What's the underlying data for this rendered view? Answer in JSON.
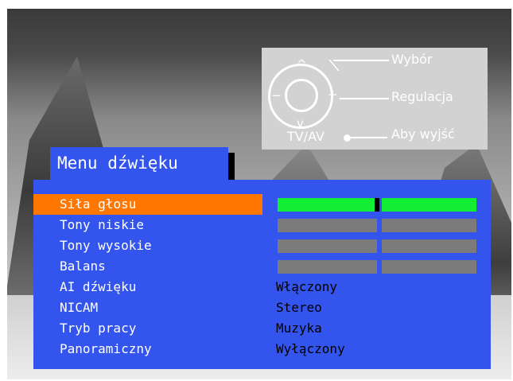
{
  "help": {
    "symbols": {
      "up": "^",
      "down": "v",
      "minus": "−",
      "plus": "+"
    },
    "tv_av_label": "TV/AV",
    "select_label": "Wybór",
    "adjust_label": "Regulacja",
    "exit_label": "Aby wyjść"
  },
  "menu": {
    "title": "Menu dźwięku",
    "items": [
      {
        "label": "Siła głosu",
        "selected": true
      },
      {
        "label": "Tony niskie"
      },
      {
        "label": "Tony wysokie"
      },
      {
        "label": "Balans"
      },
      {
        "label": "AI dźwięku",
        "value": "Włączony"
      },
      {
        "label": "NICAM",
        "value": "Stereo"
      },
      {
        "label": "Tryb pracy",
        "value": "Muzyka"
      },
      {
        "label": "Panoramiczny",
        "value": "Wyłączony"
      }
    ]
  },
  "levels": {
    "volume": 0.5,
    "bass": 0.5,
    "treble": 0.5,
    "balance": 0.5
  },
  "colors": {
    "panel": "#3355ee",
    "selected": "#ff7700",
    "active_bar": "#11ee33",
    "inactive_bar": "#7b7b7b"
  }
}
